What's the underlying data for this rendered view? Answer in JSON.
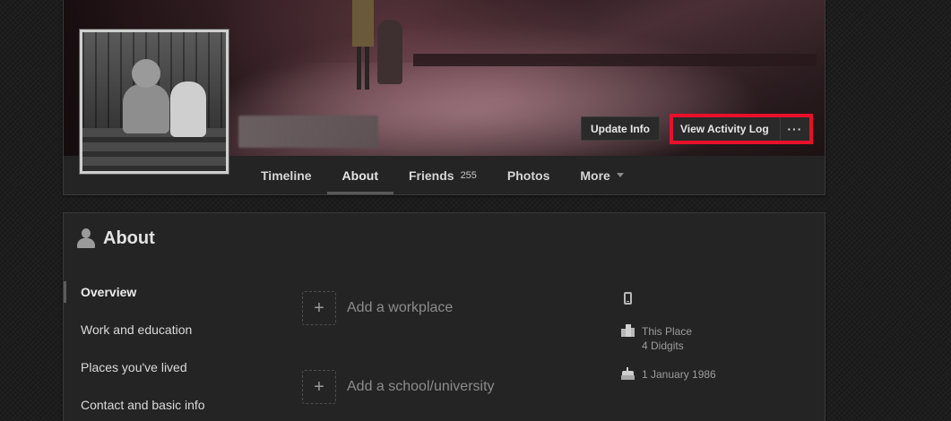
{
  "profile": {
    "buttons": {
      "update_info": "Update Info",
      "view_activity_log": "View Activity Log",
      "more_options": "···"
    },
    "tabs": [
      {
        "label": "Timeline"
      },
      {
        "label": "About",
        "active": true
      },
      {
        "label": "Friends",
        "count": "255"
      },
      {
        "label": "Photos"
      },
      {
        "label": "More"
      }
    ]
  },
  "about": {
    "title": "About",
    "nav": [
      {
        "label": "Overview",
        "active": true
      },
      {
        "label": "Work and education"
      },
      {
        "label": "Places you've lived"
      },
      {
        "label": "Contact and basic info"
      }
    ],
    "add_items": {
      "workplace": "Add a workplace",
      "school": "Add a school/university"
    },
    "side": {
      "place_line1": "This Place",
      "place_line2": "4 Didgits",
      "birthday": "1 January 1986"
    }
  },
  "icons": {
    "about": "person-icon",
    "phone": "mobile-phone-icon",
    "place": "building-icon",
    "birthday": "birthday-cake-icon",
    "add": "plus-icon",
    "more_tab": "caret-down-icon"
  },
  "colors": {
    "highlight_border": "#e8102a",
    "background": "#1d1d1d",
    "card": "#242424"
  }
}
